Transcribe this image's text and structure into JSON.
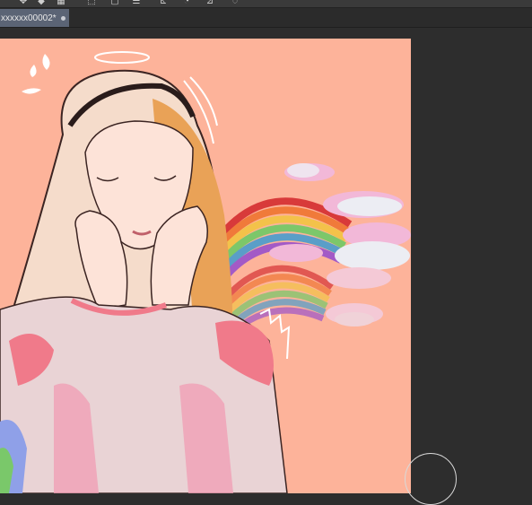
{
  "toolbar": {
    "icons": [
      "move-tool-icon",
      "lasso-icon",
      "diamond-icon",
      "grid-icon",
      "marquee-icon",
      "transform-icon",
      "rotate-icon",
      "flip-icon",
      "speech-icon"
    ]
  },
  "tabs": [
    {
      "label": "xxxxxx00002*",
      "active": true
    }
  ],
  "canvas": {
    "background": "#fdb39a",
    "workspace_bg": "#2d2d2d"
  },
  "colors": {
    "tab_active": "#5b6475",
    "rainbow": [
      "#d83a3a",
      "#f07a3a",
      "#f3c24a",
      "#7cc76a",
      "#5a9ec8",
      "#a35ac6"
    ]
  }
}
